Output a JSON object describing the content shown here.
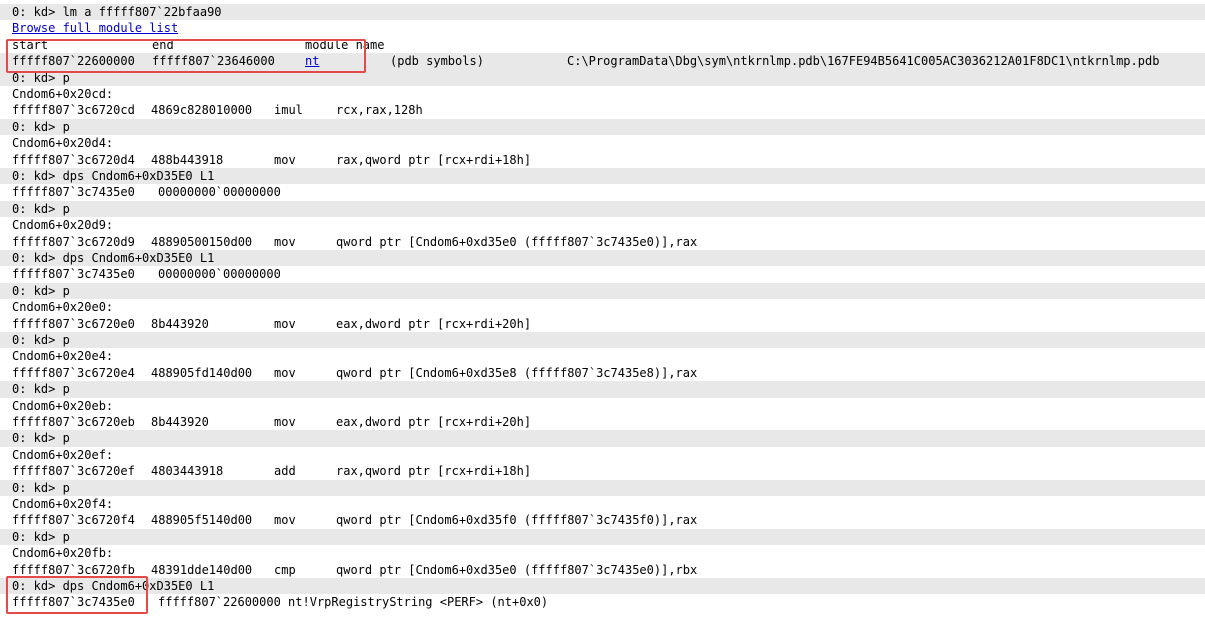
{
  "header_command": "0: kd> lm a fffff807`22bfaa90",
  "browse_link": "Browse full module list",
  "lm_header": {
    "start": "start",
    "end": "end",
    "module": "module name"
  },
  "lm_row": {
    "start": "fffff807`22600000",
    "end": "fffff807`23646000",
    "module": "nt",
    "symbols": "(pdb symbols)",
    "path": "C:\\ProgramData\\Dbg\\sym\\ntkrnlmp.pdb\\167FE94B5641C005AC3036212A01F8DC1\\ntkrnlmp.pdb"
  },
  "lines": [
    {
      "type": "cmd",
      "text": "0: kd> p"
    },
    {
      "type": "label",
      "text": "Cndom6+0x20cd:"
    },
    {
      "type": "asm",
      "addr": "fffff807`3c6720cd",
      "bytes": "4869c828010000",
      "op": "imul",
      "args": "rcx,rax,128h"
    },
    {
      "type": "cmd",
      "text": "0: kd> p"
    },
    {
      "type": "label",
      "text": "Cndom6+0x20d4:"
    },
    {
      "type": "asm",
      "addr": "fffff807`3c6720d4",
      "bytes": "488b443918",
      "op": "mov",
      "args": "rax,qword ptr [rcx+rdi+18h]"
    },
    {
      "type": "cmd",
      "text": "0: kd> dps Cndom6+0xD35E0 L1"
    },
    {
      "type": "mem",
      "addr": "fffff807`3c7435e0",
      "value": "00000000`00000000"
    },
    {
      "type": "cmd",
      "text": "0: kd> p"
    },
    {
      "type": "label",
      "text": "Cndom6+0x20d9:"
    },
    {
      "type": "asm",
      "addr": "fffff807`3c6720d9",
      "bytes": "48890500150d00",
      "op": "mov",
      "args": "qword ptr [Cndom6+0xd35e0 (fffff807`3c7435e0)],rax"
    },
    {
      "type": "cmd",
      "text": "0: kd> dps Cndom6+0xD35E0 L1"
    },
    {
      "type": "mem",
      "addr": "fffff807`3c7435e0",
      "value": "00000000`00000000"
    },
    {
      "type": "cmd",
      "text": "0: kd> p"
    },
    {
      "type": "label",
      "text": "Cndom6+0x20e0:"
    },
    {
      "type": "asm",
      "addr": "fffff807`3c6720e0",
      "bytes": "8b443920",
      "op": "mov",
      "args": "eax,dword ptr [rcx+rdi+20h]"
    },
    {
      "type": "cmd",
      "text": "0: kd> p"
    },
    {
      "type": "label",
      "text": "Cndom6+0x20e4:"
    },
    {
      "type": "asm",
      "addr": "fffff807`3c6720e4",
      "bytes": "488905fd140d00",
      "op": "mov",
      "args": "qword ptr [Cndom6+0xd35e8 (fffff807`3c7435e8)],rax"
    },
    {
      "type": "cmd",
      "text": "0: kd> p"
    },
    {
      "type": "label",
      "text": "Cndom6+0x20eb:"
    },
    {
      "type": "asm",
      "addr": "fffff807`3c6720eb",
      "bytes": "8b443920",
      "op": "mov",
      "args": "eax,dword ptr [rcx+rdi+20h]"
    },
    {
      "type": "cmd",
      "text": "0: kd> p"
    },
    {
      "type": "label",
      "text": "Cndom6+0x20ef:"
    },
    {
      "type": "asm",
      "addr": "fffff807`3c6720ef",
      "bytes": "4803443918",
      "op": "add",
      "args": "rax,qword ptr [rcx+rdi+18h]"
    },
    {
      "type": "cmd",
      "text": "0: kd> p"
    },
    {
      "type": "label",
      "text": "Cndom6+0x20f4:"
    },
    {
      "type": "asm",
      "addr": "fffff807`3c6720f4",
      "bytes": "488905f5140d00",
      "op": "mov",
      "args": "qword ptr [Cndom6+0xd35f0 (fffff807`3c7435f0)],rax"
    },
    {
      "type": "cmd",
      "text": "0: kd> p"
    },
    {
      "type": "label",
      "text": "Cndom6+0x20fb:"
    },
    {
      "type": "asm",
      "addr": "fffff807`3c6720fb",
      "bytes": "48391dde140d00",
      "op": "cmp",
      "args": "qword ptr [Cndom6+0xd35e0 (fffff807`3c7435e0)],rbx"
    },
    {
      "type": "cmd",
      "text": "0: kd> dps Cndom6+0xD35E0 L1"
    },
    {
      "type": "mem",
      "addr": "fffff807`3c7435e0",
      "value": "fffff807`22600000 nt!VrpRegistryString <PERF> (nt+0x0)"
    }
  ],
  "colors": {
    "link": "#0000cc",
    "command_row_bg": "#e8e8e8",
    "highlight_box": "#e34a4a"
  }
}
